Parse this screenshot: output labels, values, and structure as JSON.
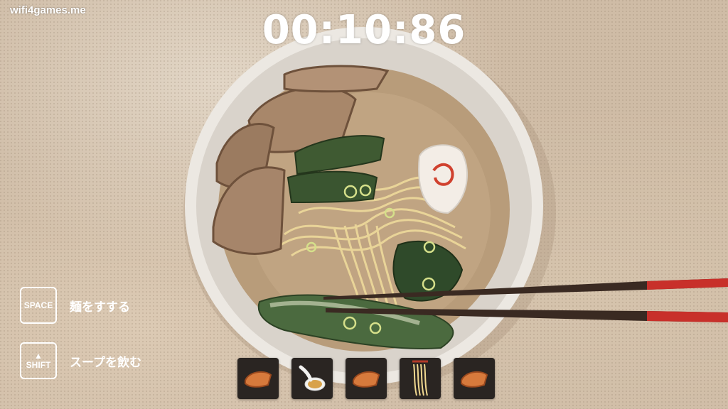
{
  "watermark": "wifi4games.me",
  "timer": "00:10:86",
  "controls": [
    {
      "key": "SPACE",
      "label": "麺をすする"
    },
    {
      "key": "SHIFT",
      "label": "スープを飲む"
    }
  ],
  "tray": [
    {
      "icon": "chashu-icon"
    },
    {
      "icon": "spoon-soup-icon"
    },
    {
      "icon": "chashu-icon"
    },
    {
      "icon": "noodles-icon"
    },
    {
      "icon": "chashu-icon"
    }
  ],
  "colors": {
    "table": "#cfbca6",
    "broth": "#b89c7a",
    "bowl": "#ece8e2",
    "chopsticks_tip": "#c8302a",
    "chopsticks_body": "#3a2a22",
    "slot": "#2a2522"
  }
}
